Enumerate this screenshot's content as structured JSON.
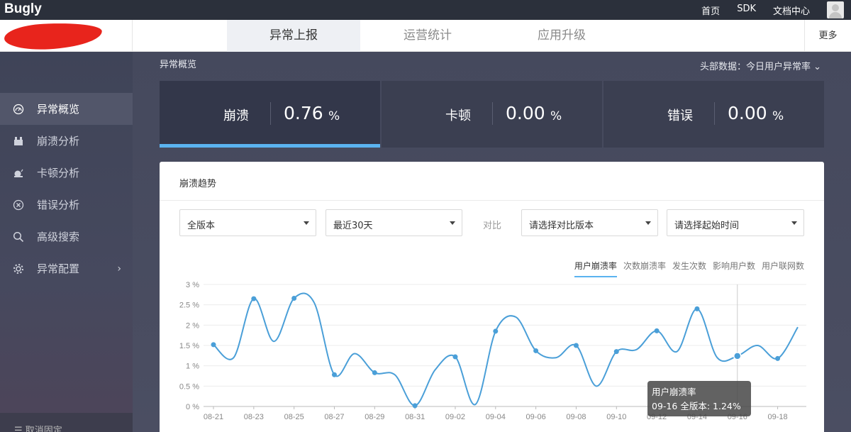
{
  "topbar": {
    "logo": "Bugly",
    "links": [
      "首页",
      "SDK",
      "文档中心"
    ]
  },
  "nav": {
    "tabs": [
      "异常上报",
      "运营统计",
      "应用升级"
    ],
    "active_tab": 0,
    "more": "更多"
  },
  "sidebar": {
    "items": [
      {
        "label": "异常概览",
        "icon": "dashboard-icon"
      },
      {
        "label": "崩溃分析",
        "icon": "crash-icon"
      },
      {
        "label": "卡顿分析",
        "icon": "snail-icon"
      },
      {
        "label": "错误分析",
        "icon": "error-x-icon"
      },
      {
        "label": "高级搜索",
        "icon": "search-icon"
      },
      {
        "label": "异常配置",
        "icon": "gear-icon"
      }
    ],
    "active_index": 0,
    "bottom_text": "取消固定"
  },
  "main": {
    "section_title": "异常概览",
    "head_data_label": "头部数据：今日用户异常率",
    "stats": [
      {
        "label": "崩溃",
        "value": "0.76",
        "unit": "%"
      },
      {
        "label": "卡顿",
        "value": "0.00",
        "unit": "%"
      },
      {
        "label": "错误",
        "value": "0.00",
        "unit": "%"
      }
    ]
  },
  "card": {
    "title": "崩溃趋势",
    "filters": {
      "version": "全版本",
      "range": "最近30天",
      "compare_label": "对比",
      "compare_version": "请选择对比版本",
      "start_time": "请选择起始时间"
    },
    "metric_tabs": [
      "用户崩溃率",
      "次数崩溃率",
      "发生次数",
      "影响用户数",
      "用户联网数"
    ],
    "active_metric": 0,
    "tooltip": {
      "title": "用户崩溃率",
      "date": "09-16",
      "series": "全版本:",
      "value": "1.24%"
    }
  },
  "colors": {
    "accent": "#5bb3f0",
    "line": "#4a9fd8",
    "topbar": "#2b303b"
  },
  "chart_data": {
    "type": "line",
    "x": [
      "08-21",
      "08-22",
      "08-23",
      "08-24",
      "08-25",
      "08-26",
      "08-27",
      "08-28",
      "08-29",
      "08-30",
      "08-31",
      "09-01",
      "09-02",
      "09-03",
      "09-04",
      "09-05",
      "09-06",
      "09-07",
      "09-08",
      "09-09",
      "09-10",
      "09-11",
      "09-12",
      "09-13",
      "09-14",
      "09-15",
      "09-16",
      "09-17",
      "09-18",
      "09-19"
    ],
    "x_tick_labels": [
      "08-21",
      "08-23",
      "08-25",
      "08-27",
      "08-29",
      "08-31",
      "09-02",
      "09-04",
      "09-06",
      "09-08",
      "09-10",
      "09-12",
      "09-14",
      "09-16",
      "09-18"
    ],
    "series": [
      {
        "values": [
          1.52,
          1.2,
          2.65,
          1.6,
          2.66,
          2.55,
          0.78,
          1.3,
          0.83,
          0.78,
          0.02,
          0.9,
          1.22,
          0.05,
          1.85,
          2.2,
          1.37,
          1.2,
          1.5,
          0.5,
          1.35,
          1.4,
          1.86,
          1.35,
          2.4,
          1.2,
          1.24,
          1.5,
          1.18,
          1.95
        ]
      }
    ],
    "y_ticks": [
      "0 %",
      "0.5 %",
      "1 %",
      "1.5 %",
      "2 %",
      "2.5 %",
      "3 %"
    ],
    "ylim": [
      0,
      3
    ],
    "grid": true,
    "highlight_x": "09-16"
  }
}
